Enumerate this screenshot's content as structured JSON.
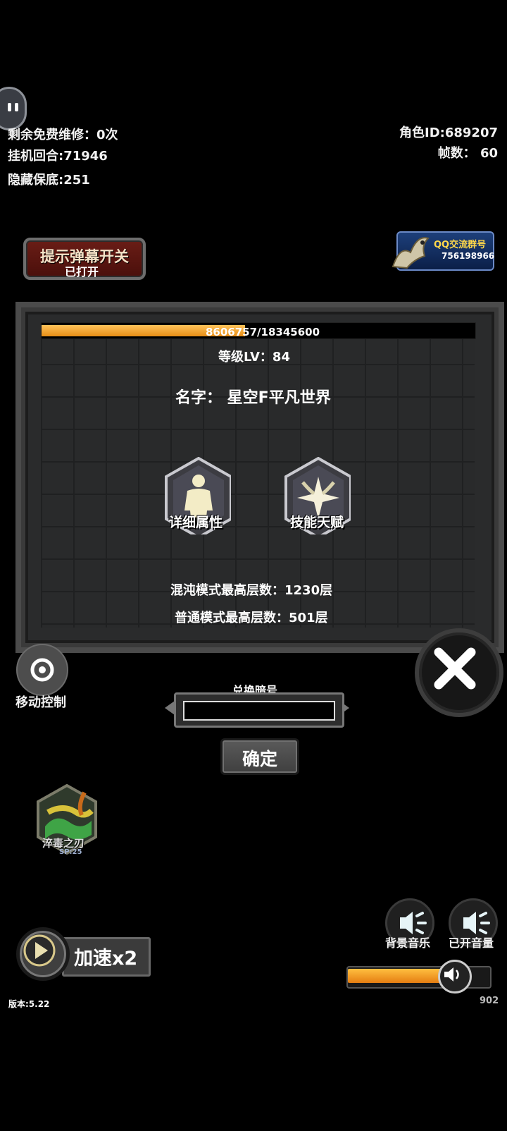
{
  "status": {
    "repair_left": "剩余免费维修：0次",
    "idle_rounds": "挂机回合:71946",
    "hidden_pity": "隐藏保底:251",
    "role_id": "角色ID:689207",
    "fps": "帧数：  60"
  },
  "hint_toggle": {
    "title": "提示弹幕开关",
    "state": "已打开"
  },
  "qq_group": {
    "title": "QQ交流群号",
    "number": "756198966"
  },
  "character": {
    "xp_current": 8606757,
    "xp_max": 18345600,
    "xp_text": "8606757/18345600",
    "level": "等级LV：84",
    "name": "名字：  星空F平凡世界",
    "chaos_best": "混沌模式最高层数：1230层",
    "normal_best": "普通模式最高层数：501层"
  },
  "panel_buttons": {
    "details": "详细属性",
    "skills": "技能天赋"
  },
  "movement": {
    "label": "移动控制"
  },
  "redeem": {
    "title": "兑换暗号",
    "value": "",
    "confirm": "确定"
  },
  "skill": {
    "name": "淬毒之刃",
    "sp": "SP:25"
  },
  "speed": {
    "label": "加速x2"
  },
  "sound": {
    "bgm_label": "背景音乐",
    "volume_label": "已开音量",
    "volume_value": "902",
    "volume_fraction": 0.7
  },
  "version": "版本:5.22",
  "colors": {
    "xp_bar": "#f0a030",
    "hint_bg": "#6a1d16",
    "qq_bg": "#1d3f7a"
  }
}
